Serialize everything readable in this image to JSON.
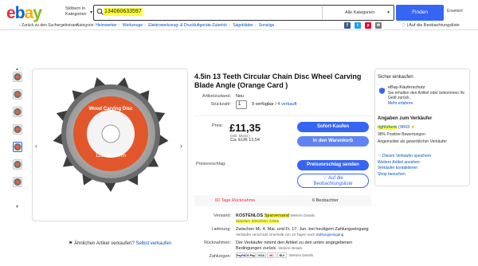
{
  "header": {
    "logo": "ebay",
    "category_button": "Stöbern in Kategorien",
    "search_value": "134060633597",
    "category_select": "Alle Kategorien",
    "find_button": "Finden",
    "advanced_link": "Erweitert"
  },
  "breadcrumb": {
    "back": "Zurück zu den Suchergebnissen",
    "items": [
      "Heimwerker",
      "Werkzeuge",
      "Elektrowerkzeug- & Druckluftgeräte-Zubehör",
      "Sägeblätter",
      "Sonstige"
    ],
    "prefix": "Kategorie:"
  },
  "share_icons": [
    "facebook-icon",
    "twitter-icon",
    "pinterest-icon",
    "mail-icon"
  ],
  "watchlist_link": "Auf die Beobachtungsliste",
  "product": {
    "title": "4.5in 13 Teeth Circular Chain Disc Wheel Carving Blade Angle (Orange Card )",
    "image_label_top": "Wood Carving Disc",
    "image_label_size": "115X22.23mm",
    "condition_label": "Artikelzustand:",
    "condition_value": "Neu",
    "qty_label": "Stückzahl:",
    "qty_value": "1",
    "availability": "9 verfügbar /",
    "sold": "4 verkauft",
    "price_label": "Preis:",
    "price": "£11,35",
    "price_incl": "(inkl. MwSt.)",
    "price_approx": "Ca. EUR 13,54",
    "buy_button": "Sofort-Kaufen",
    "cart_button": "In den Warenkorb",
    "offer_label": "Preisvorschlag:",
    "offer_button": "Preisvorschlag senden",
    "watch_button_line1": "Auf die",
    "watch_button_line2": "Beobachtungsliste",
    "returns": "60 Tage Rücknahme",
    "watchers": "6 Beobachter",
    "shipping_label": "Versand:",
    "shipping_value": "KOSTENLOS",
    "shipping_method": "Sparversand",
    "shipping_details": "Weitere Details",
    "shipping_location": "Standort: Shenzhen, China",
    "delivery_label": "Lieferung:",
    "delivery_value": "Zwischen Mi. 4. Mai. und Fr. 17. Jun. bei heutigem Zahlungseingang",
    "delivery_note": "Verkäufer verschickt innerhalb von 10 Tagen nach",
    "delivery_note_link": "Zahlungseingang",
    "returns_label": "Rücknahmen:",
    "returns_value": "Der Verkäufer nimmt den Artikel zu den unten angegebenen Bedingungen zurück.",
    "returns_link": "Weitere Details",
    "payment_label": "Zahlungen:",
    "payment_icons": [
      "PayPal",
      "G Pay",
      "VISA",
      "MC",
      "ELV"
    ],
    "payment_link": "Weitere Details"
  },
  "similar": {
    "text": "Ähnlichen Artikel verkaufen?",
    "link": "Selbst verkaufen"
  },
  "seller_panel": {
    "safe_title": "Sicher einkaufen",
    "safe_head": "eBay-Käuferschutz",
    "safe_text": "Sie erhalten den Artikel oder bekommen Ihr Geld zurück.",
    "safe_more": "Mehr erfahren",
    "seller_head": "Angaben zum Verkäufer",
    "seller_name": "rightshere",
    "seller_score": "(9603",
    "seller_positive": "98% Positive Bewertungen",
    "seller_since": "Angemeldet als gewerblicher Verkäufer",
    "links": [
      "Diesen Verkäufer speichern",
      "Weitere Artikel ansehen",
      "Verkäufer kontaktieren",
      "Shop besuchen"
    ]
  },
  "colors": {
    "accent": "#3665f3",
    "highlight": "#ffff3c",
    "returns_red": "#e53238"
  }
}
